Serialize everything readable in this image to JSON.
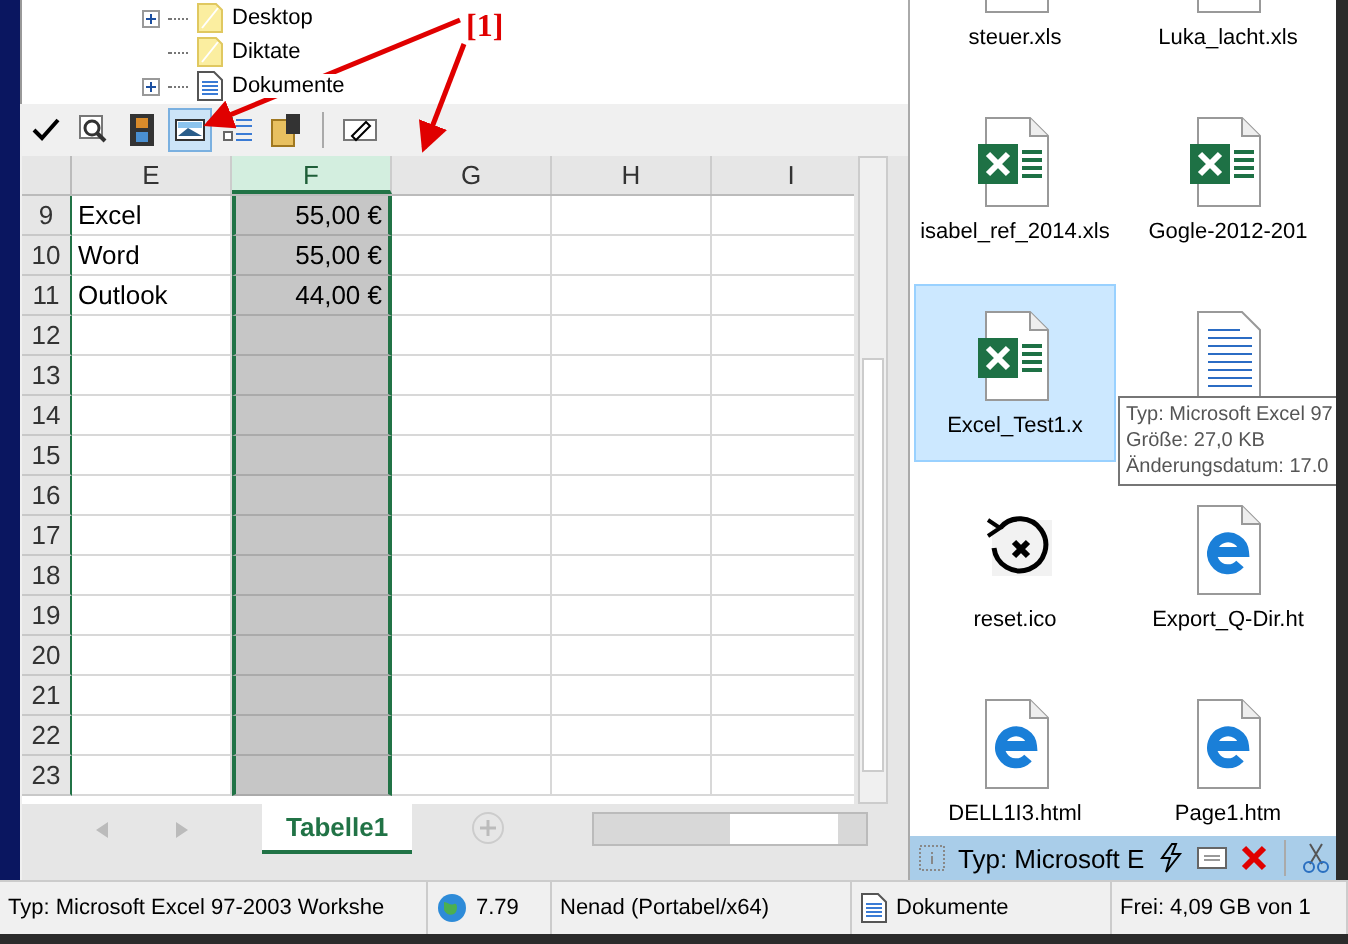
{
  "tree": [
    {
      "label": "Desktop",
      "kind": "folder",
      "has_children": true
    },
    {
      "label": "Diktate",
      "kind": "folder",
      "has_children": false
    },
    {
      "label": "Dokumente",
      "kind": "document",
      "has_children": true
    }
  ],
  "toolbar": [
    {
      "kind": "check",
      "selected": false,
      "separator_before": false
    },
    {
      "kind": "preview",
      "selected": false,
      "separator_before": false
    },
    {
      "kind": "film",
      "selected": false,
      "separator_before": false
    },
    {
      "kind": "picture",
      "selected": true,
      "separator_before": false
    },
    {
      "kind": "list",
      "selected": false,
      "separator_before": false
    },
    {
      "kind": "film-folder",
      "selected": false,
      "separator_before": false
    },
    {
      "kind": "eyedropper",
      "selected": false,
      "separator_before": true
    }
  ],
  "annotation": {
    "label": "[1]"
  },
  "sheet": {
    "columns": [
      {
        "label": "E",
        "selected": false
      },
      {
        "label": "F",
        "selected": true
      },
      {
        "label": "G",
        "selected": false
      },
      {
        "label": "H",
        "selected": false
      },
      {
        "label": "I",
        "selected": false
      }
    ],
    "rows": [
      {
        "number": "9",
        "cells": [
          "Excel",
          "55,00 €"
        ]
      },
      {
        "number": "10",
        "cells": [
          "Word",
          "55,00 €"
        ]
      },
      {
        "number": "11",
        "cells": [
          "Outlook",
          "44,00 €"
        ]
      },
      {
        "number": "12"
      },
      {
        "number": "13"
      },
      {
        "number": "14"
      },
      {
        "number": "15"
      },
      {
        "number": "16"
      },
      {
        "number": "17"
      },
      {
        "number": "18"
      },
      {
        "number": "19"
      },
      {
        "number": "20"
      },
      {
        "number": "21"
      },
      {
        "number": "22"
      },
      {
        "number": "23"
      }
    ],
    "tabs": [
      {
        "label": "Tabelle1",
        "selected": true
      }
    ]
  },
  "files": [
    {
      "name": "steuer.xls",
      "kind": "excel",
      "selected": false
    },
    {
      "name": "Luka_lacht.xls",
      "kind": "excel",
      "selected": false
    },
    {
      "name": "isabel_ref_2014.xls",
      "kind": "excel",
      "selected": false
    },
    {
      "name": "Gogle-2012-201",
      "kind": "excel",
      "selected": false
    },
    {
      "name": "Excel_Test1.x",
      "kind": "excel",
      "selected": true
    },
    {
      "kind": "doc",
      "selected": false
    },
    {
      "name": "reset.ico",
      "kind": "reset",
      "selected": false
    },
    {
      "name": "Export_Q-Dir.ht",
      "kind": "edge",
      "selected": false
    },
    {
      "name": "DELL1I3.html",
      "kind": "edge",
      "selected": false
    },
    {
      "name": "Page1.htm",
      "kind": "edge",
      "selected": false
    }
  ],
  "tooltip": {
    "lines": [
      "Typ: Microsoft Excel 97",
      "Größe: 27,0 KB",
      "Änderungsdatum: 17.0"
    ]
  },
  "file_status": {
    "text": "Typ: Microsoft E"
  },
  "status_bar": [
    {
      "kind": "text",
      "text": "Typ: Microsoft Excel 97-2003 Workshe"
    },
    {
      "kind": "globe",
      "text": "7.79"
    },
    {
      "kind": "text",
      "text": "Nenad (Portabel/x64)"
    },
    {
      "kind": "document",
      "text": "Dokumente"
    },
    {
      "kind": "text",
      "text": "Frei: 4,09 GB von 1"
    }
  ]
}
